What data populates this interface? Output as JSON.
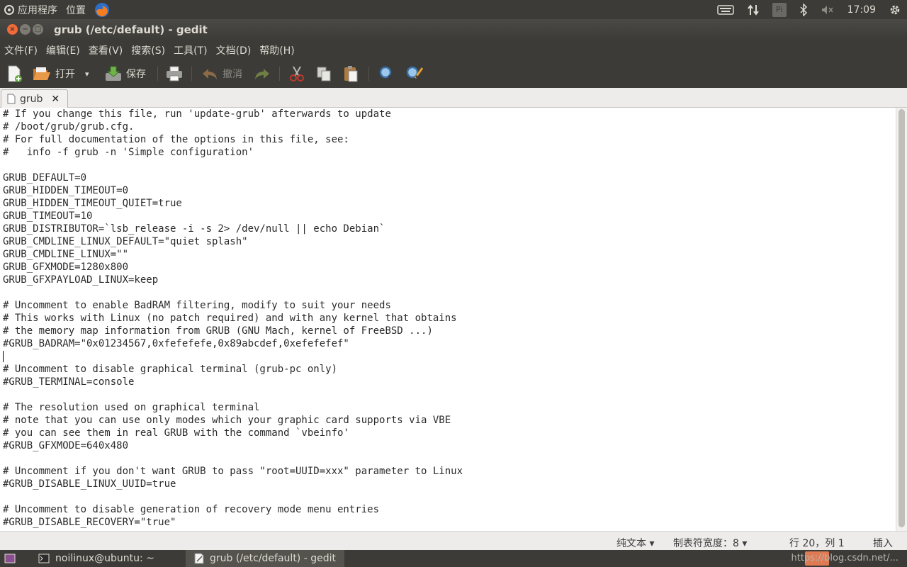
{
  "topbar": {
    "apps_label": "应用程序",
    "places_label": "位置",
    "clock": "17:09",
    "pinyin_indicator": "Pi",
    "icons": [
      "ubuntu-logo-icon",
      "firefox-icon",
      "keyboard-icon",
      "network-arrows-icon",
      "bluetooth-icon",
      "volume-muted-icon",
      "power-gear-icon"
    ]
  },
  "window": {
    "title": "grub (/etc/default) - gedit",
    "close_symbol": "×",
    "min_symbol": "−",
    "max_symbol": "□"
  },
  "menubar": {
    "items": [
      "文件(F)",
      "编辑(E)",
      "查看(V)",
      "搜索(S)",
      "工具(T)",
      "文档(D)",
      "帮助(H)"
    ]
  },
  "toolbar": {
    "open_label": "打开",
    "save_label": "保存",
    "undo_label": "撤消",
    "dropdown_symbol": "▾"
  },
  "tab": {
    "label": "grub",
    "close_symbol": "✕"
  },
  "editor": {
    "lines": [
      "# If you change this file, run 'update-grub' afterwards to update",
      "# /boot/grub/grub.cfg.",
      "# For full documentation of the options in this file, see:",
      "#   info -f grub -n 'Simple configuration'",
      "",
      "GRUB_DEFAULT=0",
      "GRUB_HIDDEN_TIMEOUT=0",
      "GRUB_HIDDEN_TIMEOUT_QUIET=true",
      "GRUB_TIMEOUT=10",
      "GRUB_DISTRIBUTOR=`lsb_release -i -s 2> /dev/null || echo Debian`",
      "GRUB_CMDLINE_LINUX_DEFAULT=\"quiet splash\"",
      "GRUB_CMDLINE_LINUX=\"\"",
      "GRUB_GFXMODE=1280x800",
      "GRUB_GFXPAYLOAD_LINUX=keep",
      "",
      "# Uncomment to enable BadRAM filtering, modify to suit your needs",
      "# This works with Linux (no patch required) and with any kernel that obtains",
      "# the memory map information from GRUB (GNU Mach, kernel of FreeBSD ...)",
      "#GRUB_BADRAM=\"0x01234567,0xfefefefe,0x89abcdef,0xefefefef\"",
      "",
      "# Uncomment to disable graphical terminal (grub-pc only)",
      "#GRUB_TERMINAL=console",
      "",
      "# The resolution used on graphical terminal",
      "# note that you can use only modes which your graphic card supports via VBE",
      "# you can see them in real GRUB with the command `vbeinfo'",
      "#GRUB_GFXMODE=640x480",
      "",
      "# Uncomment if you don't want GRUB to pass \"root=UUID=xxx\" parameter to Linux",
      "#GRUB_DISABLE_LINUX_UUID=true",
      "",
      "# Uncomment to disable generation of recovery mode menu entries",
      "#GRUB_DISABLE_RECOVERY=\"true\""
    ],
    "cursor_line": 20
  },
  "statusbar": {
    "language": "纯文本 ▾",
    "tab_width": "制表符宽度：8 ▾",
    "position": "行 20，列 1",
    "mode": "插入"
  },
  "taskbar": {
    "terminal_label": "noilinux@ubuntu: ~",
    "gedit_label": "grub (/etc/default) - gedit",
    "watermark": "https://blog.csdn.net/..."
  },
  "colors": {
    "panel_bg": "#3c3b37",
    "close_button": "#f06a3a",
    "editor_bg": "#ffffff"
  }
}
